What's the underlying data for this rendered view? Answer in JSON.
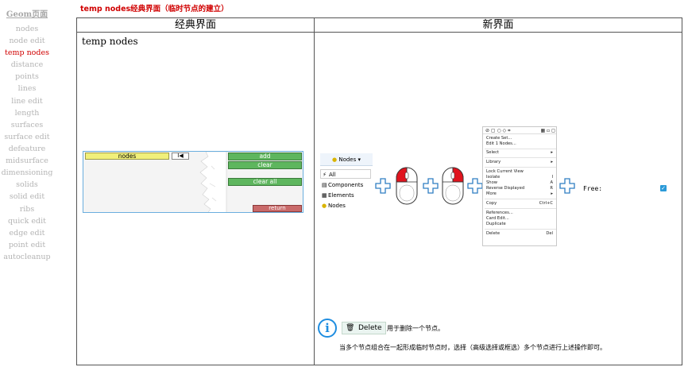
{
  "sidebar": {
    "heading": "Geom页面",
    "items": [
      "nodes",
      "node edit",
      "temp nodes",
      "distance",
      "points",
      "lines",
      "line edit",
      "length",
      "surfaces",
      "surface edit",
      "defeature",
      "midsurface",
      "dimensioning",
      "solids",
      "solid edit",
      "ribs",
      "quick edit",
      "edge edit",
      "point edit",
      "autocleanup"
    ],
    "active_item": "temp nodes"
  },
  "page_title": "temp nodes经典界面（临时节点的建立）",
  "table": {
    "classic_header": "经典界面",
    "new_header": "新界面"
  },
  "classic": {
    "heading": "temp nodes",
    "panel": {
      "nodes_label": "nodes",
      "first_label": "I◀",
      "add_label": "add",
      "clear_label": "clear",
      "clear_all_label": "clear all",
      "return_label": "return"
    }
  },
  "new_ui": {
    "tree": {
      "header": "Nodes ▾",
      "items": [
        {
          "label": "All",
          "icon": "filter-icon"
        },
        {
          "label": "Components",
          "icon": "components-icon"
        },
        {
          "label": "Elements",
          "icon": "elements-icon"
        },
        {
          "label": "Nodes",
          "icon": "node-icon"
        }
      ]
    },
    "context_menu": {
      "toolbar": "⊘ ▢ ○ ◇ ⌗",
      "toolbar_right": "▦ ▫ ◻",
      "items": [
        {
          "label": "Create Set...",
          "key": ""
        },
        {
          "label": "Edit 1 Nodes...",
          "key": ""
        },
        {
          "label": "Select",
          "key": "▸"
        },
        {
          "label": "Library",
          "key": "▸"
        },
        {
          "label": "Lock Current View",
          "key": ""
        },
        {
          "label": "Isolate",
          "key": "I"
        },
        {
          "label": "Show",
          "key": "A"
        },
        {
          "label": "Reverse Displayed",
          "key": "R"
        },
        {
          "label": "More",
          "key": "▸"
        },
        {
          "label": "Copy",
          "key": "Ctrl+C"
        },
        {
          "label": "References...",
          "key": ""
        },
        {
          "label": "Card Edit...",
          "key": ""
        },
        {
          "label": "Duplicate",
          "key": ""
        },
        {
          "label": "Delete",
          "key": "Del"
        }
      ]
    },
    "free_label": "Free:",
    "checkbox_mark": "✓",
    "info_icon": "i",
    "delete_button": "Delete",
    "delete_desc": "用于删除一个节点。",
    "note": "当多个节点组合在一起形成临时节点时，选择（高级选择或框选）多个节点进行上述操作即可。"
  },
  "colors": {
    "active": "#d00000",
    "muted": "#b4b4b4",
    "green_button": "#5eb65e",
    "red_button": "#c96a6a",
    "mouse_red": "#e0141e",
    "plus_blue": "#2f7ec2",
    "info_blue": "#1e8de0"
  }
}
